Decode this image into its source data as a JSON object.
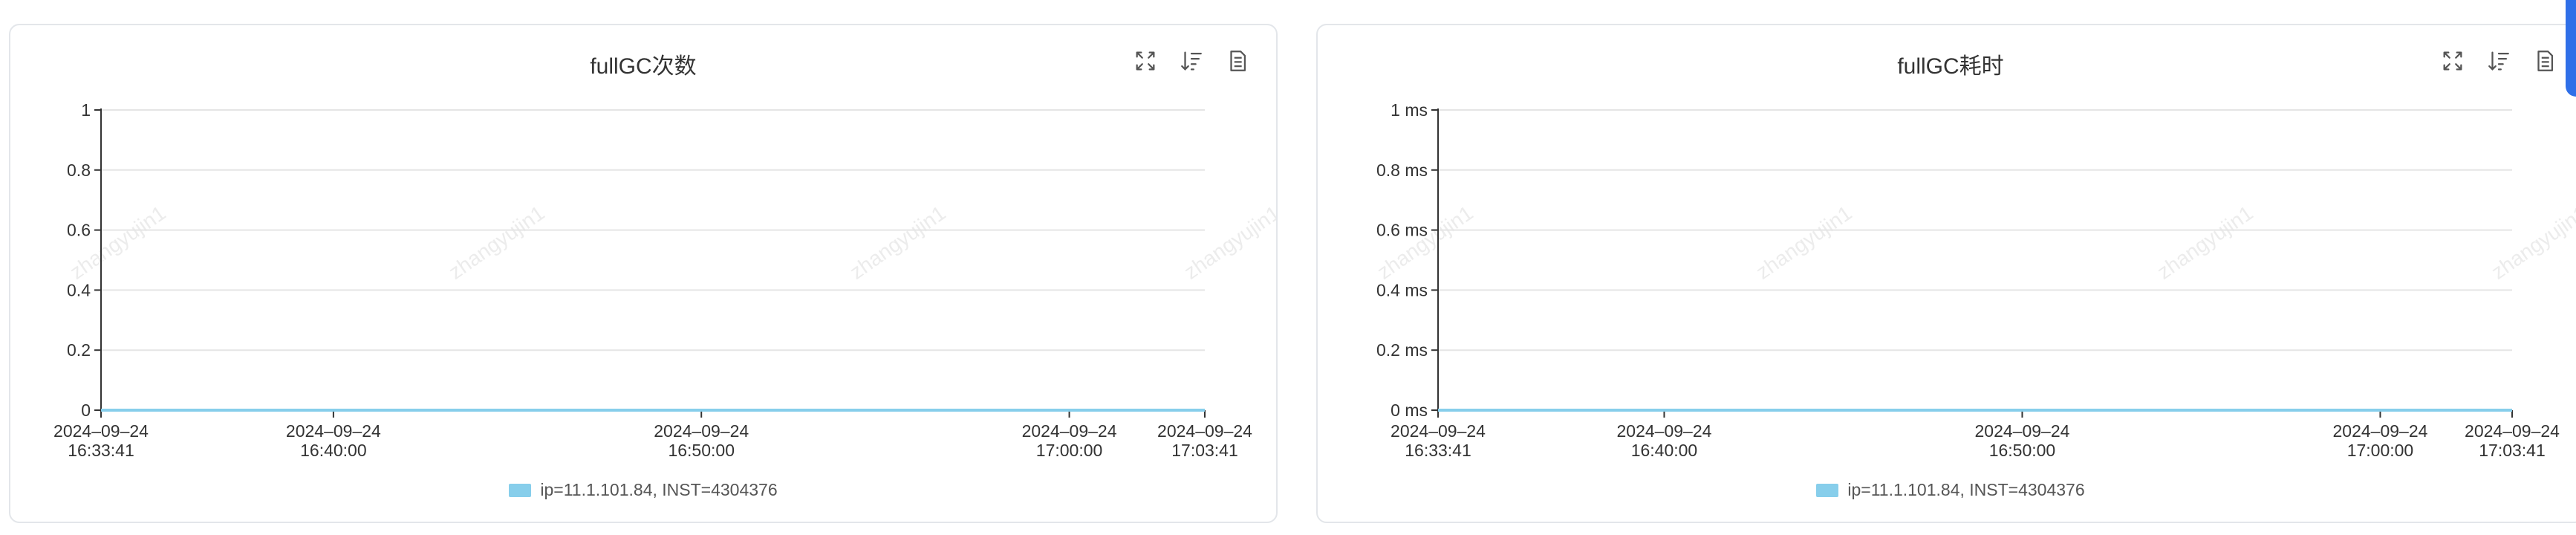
{
  "colors": {
    "series": "#87ceeb",
    "grid": "#e5e5e5",
    "axis": "#333333",
    "watermark": "#ececec"
  },
  "icons": [
    "fullscreen-icon",
    "sort-icon",
    "data-view-icon"
  ],
  "watermark_text": "zhangyujin1",
  "chart_data": [
    {
      "type": "line",
      "title": "fullGC次数",
      "ylim": [
        0,
        1
      ],
      "y_ticks": [
        "0",
        "0.2",
        "0.4",
        "0.6",
        "0.8",
        "1"
      ],
      "y_tick_values": [
        0,
        0.2,
        0.4,
        0.6,
        0.8,
        1
      ],
      "x_time_range": [
        "2024-09-24 16:33:41",
        "2024-09-24 17:03:41"
      ],
      "x_ticks": [
        {
          "date": "2024–09–24",
          "time": "16:33:41",
          "t": "16:33:41"
        },
        {
          "date": "2024–09–24",
          "time": "16:40:00",
          "t": "16:40:00"
        },
        {
          "date": "2024–09–24",
          "time": "16:50:00",
          "t": "16:50:00"
        },
        {
          "date": "2024–09–24",
          "time": "17:00:00",
          "t": "17:00:00"
        },
        {
          "date": "2024–09–24",
          "time": "17:03:41",
          "t": "17:03:41"
        }
      ],
      "series": [
        {
          "name": "ip=11.1.101.84, INST=4304376",
          "x": [
            "16:33:41",
            "17:03:41"
          ],
          "values": [
            0,
            0
          ]
        }
      ],
      "grid": true,
      "legend_position": "bottom"
    },
    {
      "type": "line",
      "title": "fullGC耗时",
      "ylim": [
        0,
        1
      ],
      "y_ticks": [
        "0 ms",
        "0.2 ms",
        "0.4 ms",
        "0.6 ms",
        "0.8 ms",
        "1 ms"
      ],
      "y_tick_values": [
        0,
        0.2,
        0.4,
        0.6,
        0.8,
        1
      ],
      "x_time_range": [
        "2024-09-24 16:33:41",
        "2024-09-24 17:03:41"
      ],
      "x_ticks": [
        {
          "date": "2024–09–24",
          "time": "16:33:41",
          "t": "16:33:41"
        },
        {
          "date": "2024–09–24",
          "time": "16:40:00",
          "t": "16:40:00"
        },
        {
          "date": "2024–09–24",
          "time": "16:50:00",
          "t": "16:50:00"
        },
        {
          "date": "2024–09–24",
          "time": "17:00:00",
          "t": "17:00:00"
        },
        {
          "date": "2024–09–24",
          "time": "17:03:41",
          "t": "17:03:41"
        }
      ],
      "series": [
        {
          "name": "ip=11.1.101.84, INST=4304376",
          "x": [
            "16:33:41",
            "17:03:41"
          ],
          "values": [
            0,
            0
          ]
        }
      ],
      "grid": true,
      "legend_position": "bottom"
    }
  ]
}
